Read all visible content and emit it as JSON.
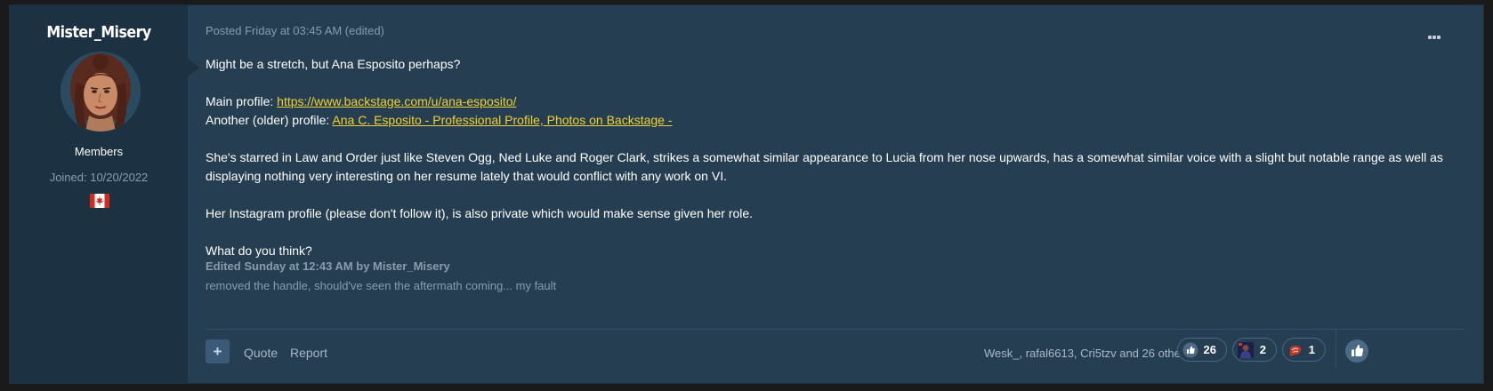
{
  "author": {
    "name": "Mister_Misery",
    "group": "Members",
    "joined": "Joined: 10/20/2022",
    "avatar_icon": "character-portrait",
    "flag_icon": "canada-flag-icon"
  },
  "post": {
    "meta": "Posted Friday at 03:45 AM (edited)",
    "more_icon": "ellipsis-icon",
    "line1": "Might be a stretch, but Ana Esposito perhaps?",
    "main_profile_label": "Main profile: ",
    "main_profile_link": "https://www.backstage.com/u/ana-esposito/",
    "older_profile_label": "Another (older) profile: ",
    "older_profile_link": "Ana C. Esposito - Professional Profile, Photos on Backstage -",
    "paragraph3": "She's starred in Law and Order just like Steven Ogg, Ned Luke and Roger Clark, strikes a somewhat similar appearance to Lucia from her nose upwards, has a somewhat similar voice with a slight but notable range as well as displaying nothing very interesting on her resume lately that would conflict with any work on VI.",
    "paragraph4": "Her Instagram profile (please don't follow it), is also private which would make sense given her role.",
    "paragraph5": "What do you think?",
    "edited": "Edited Sunday at 12:43 AM by Mister_Misery",
    "edit_reason": "removed the handle, should've seen the aftermath coming... my fault"
  },
  "footer": {
    "plus_label": "+",
    "quote_label": "Quote",
    "report_label": "Report",
    "reactors_text": "Wesk_, rafal6613, Cri5tzv and 26 others",
    "reactions": [
      {
        "icon": "thumbs-up-icon",
        "count": "26"
      },
      {
        "icon": "character-avatar-icon",
        "count": "2"
      },
      {
        "icon": "steak-icon",
        "count": "1"
      }
    ],
    "like_icon": "thumbs-up-icon"
  },
  "colors": {
    "link": "#f2d133",
    "post_bg": "#253e52",
    "author_bg": "#1c3243",
    "muted_text": "#8a9cab"
  }
}
